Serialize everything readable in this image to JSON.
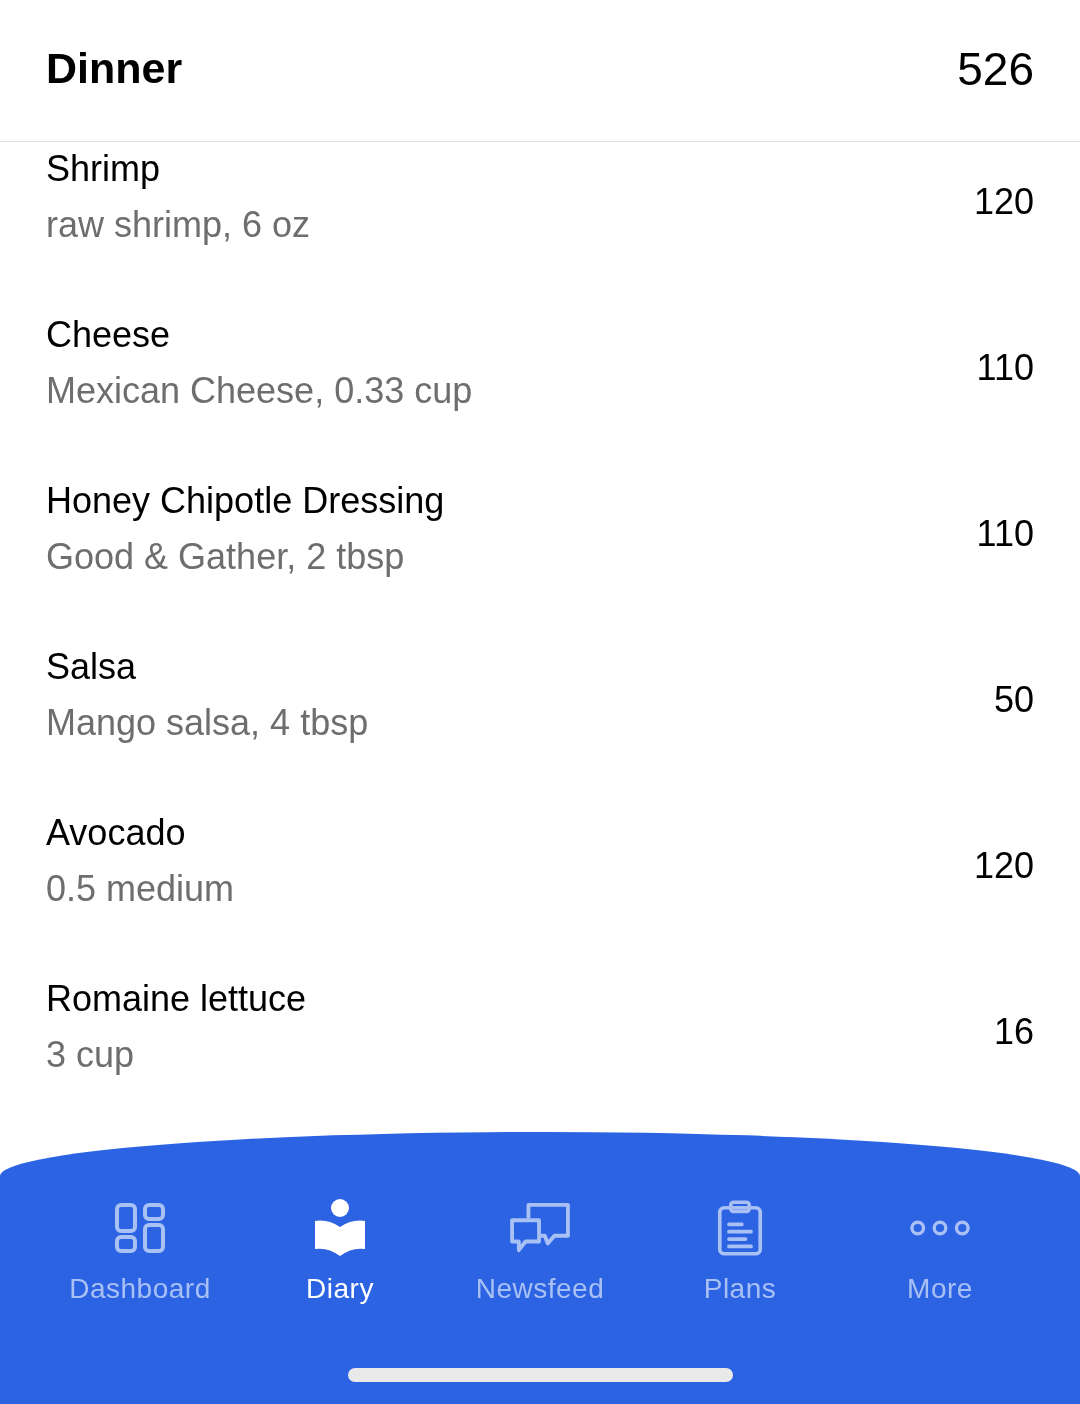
{
  "header": {
    "title": "Dinner",
    "calories": "526"
  },
  "foods": [
    {
      "name": "Shrimp",
      "detail": "raw shrimp, 6 oz",
      "calories": "120"
    },
    {
      "name": "Cheese",
      "detail": "Mexican Cheese, 0.33 cup",
      "calories": "110"
    },
    {
      "name": "Honey Chipotle Dressing",
      "detail": "Good & Gather, 2 tbsp",
      "calories": "110"
    },
    {
      "name": "Salsa",
      "detail": "Mango salsa, 4 tbsp",
      "calories": "50"
    },
    {
      "name": "Avocado",
      "detail": "0.5 medium",
      "calories": "120"
    },
    {
      "name": "Romaine lettuce",
      "detail": "3 cup",
      "calories": "16"
    }
  ],
  "tabs": [
    {
      "label": "Dashboard",
      "selected": false
    },
    {
      "label": "Diary",
      "selected": true
    },
    {
      "label": "Newsfeed",
      "selected": false
    },
    {
      "label": "Plans",
      "selected": false
    },
    {
      "label": "More",
      "selected": false
    }
  ]
}
